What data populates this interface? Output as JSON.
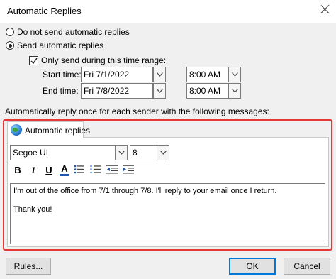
{
  "window": {
    "title": "Automatic Replies"
  },
  "options": {
    "no_replies_label": "Do not send automatic replies",
    "send_replies_label": "Send automatic replies",
    "time_range_label": "Only send during this time range:",
    "selected": "send_replies",
    "time_range_checked": true
  },
  "start": {
    "label": "Start time:",
    "date": "Fri 7/1/2022",
    "time": "8:00 AM"
  },
  "end": {
    "label": "End time:",
    "date": "Fri 7/8/2022",
    "time": "8:00 AM"
  },
  "instruction": "Automatically reply once for each sender with the following messages:",
  "tab": {
    "label": "Automatic replies"
  },
  "editor": {
    "font": "Segoe UI",
    "size": "8",
    "format": {
      "bold": "B",
      "italic": "I",
      "underline": "U",
      "font_color": "A"
    },
    "font_color_hex": "#1e5aa8",
    "message_line1": "I'm out of the office from 7/1 through 7/8. I'll reply to your email once I return.",
    "message_line2": "Thank you!"
  },
  "buttons": {
    "rules": "Rules...",
    "ok": "OK",
    "cancel": "Cancel"
  },
  "colors": {
    "highlight_border": "#e53935",
    "default_button_border": "#0078d7"
  }
}
